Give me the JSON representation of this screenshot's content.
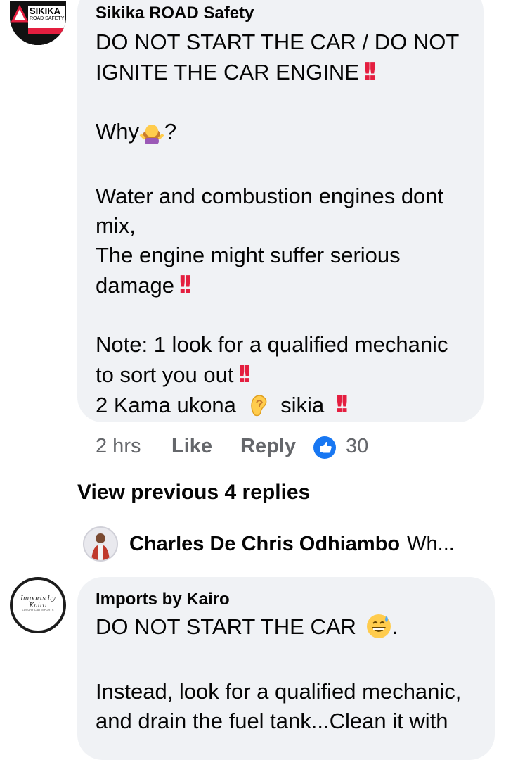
{
  "comment1": {
    "author": "Sikika ROAD Safety",
    "avatar_text": "SIKIKA",
    "avatar_sub": "ROAD SAFETY",
    "lines": [
      {
        "text": "DO NOT START THE CAR / DO NOT"
      },
      {
        "text": "IGNITE THE CAR ENGINE"
      },
      {
        "text": ""
      },
      {
        "text": "Why"
      },
      {
        "text": ""
      },
      {
        "text": "Water and combustion engines dont"
      },
      {
        "text": "mix,"
      },
      {
        "text": "The engine might suffer serious"
      },
      {
        "text": "damage"
      },
      {
        "text": ""
      },
      {
        "text": "Note: 1 look for a qualified mechanic"
      },
      {
        "text": "to sort you out"
      },
      {
        "text": "2 Kama ukona"
      }
    ],
    "why_suffix": "?",
    "sikia": "sikia",
    "time": "2 hrs",
    "like_label": "Like",
    "reply_label": "Reply",
    "reaction_count": "30"
  },
  "view_previous": "View previous 4 replies",
  "reply_preview": {
    "name": "Charles De Chris Odhiambo",
    "snippet": "Wh..."
  },
  "comment2": {
    "author": "Imports by Kairo",
    "avatar_text": "Imports by Kairo",
    "avatar_sub": "LUXURY CAR IMPORTS",
    "lines": [
      {
        "text": "DO NOT START THE CAR"
      },
      {
        "text": ""
      },
      {
        "text": "Instead, look for a qualified mechanic,"
      },
      {
        "text": "and drain the fuel tank...Clean it with"
      }
    ],
    "end_suffix": "."
  },
  "colors": {
    "bubble": "#f0f2f5",
    "meta_text": "#65676b",
    "alert_red": "#e41e3f",
    "like_blue": "#1877f2"
  }
}
